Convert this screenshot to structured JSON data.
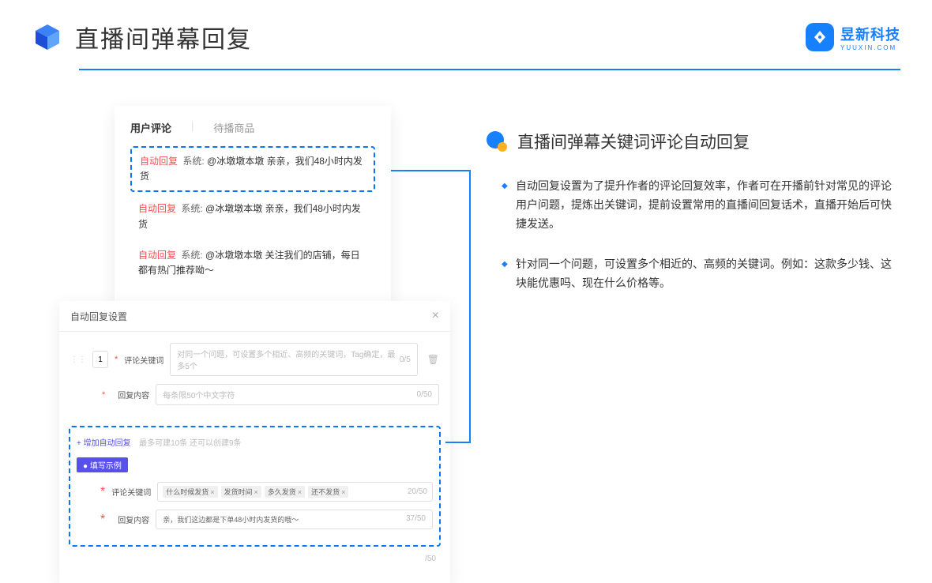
{
  "page_title": "直播间弹幕回复",
  "brand": {
    "name": "昱新科技",
    "domain": "YUUXIN.COM"
  },
  "tabs": {
    "comments": "用户评论",
    "products": "待播商品"
  },
  "comments": [
    {
      "tag": "自动回复",
      "sys": "系统:",
      "text": "@冰墩墩本墩 亲亲，我们48小时内发货"
    },
    {
      "tag": "自动回复",
      "sys": "系统:",
      "text": "@冰墩墩本墩 亲亲，我们48小时内发货"
    },
    {
      "tag": "自动回复",
      "sys": "系统:",
      "text": "@冰墩墩本墩 关注我们的店铺，每日都有热门推荐呦～"
    }
  ],
  "settings": {
    "title": "自动回复设置",
    "index": "1",
    "keyword_label": "评论关键词",
    "keyword_ph": "对同一个问题，可设置多个相近、高频的关键词，Tag确定，最多5个",
    "keyword_counter": "0/5",
    "content_label": "回复内容",
    "content_ph": "每条限50个中文字符",
    "content_counter": "0/50",
    "add_link": "+ 增加自动回复",
    "add_hint": "最多可建10条 还可以创建9条",
    "example_chip": "● 填写示例",
    "ex_keyword_label": "评论关键词",
    "ex_tags": [
      "什么时候发货",
      "发货时间",
      "多久发货",
      "还不发货"
    ],
    "ex_keyword_counter": "20/50",
    "ex_content_label": "回复内容",
    "ex_content_text": "亲，我们这边都是下单48小时内发货的哦～",
    "ex_content_counter": "37/50",
    "orphan_counter": "/50"
  },
  "section": {
    "title": "直播间弹幕关键词评论自动回复",
    "bullets": [
      "自动回复设置为了提升作者的评论回复效率，作者可在开播前针对常见的评论用户问题，提炼出关键词，提前设置常用的直播间回复话术，直播开始后可快捷发送。",
      "针对同一个问题，可设置多个相近的、高频的关键词。例如：这款多少钱、这块能优惠吗、现在什么价格等。"
    ]
  }
}
